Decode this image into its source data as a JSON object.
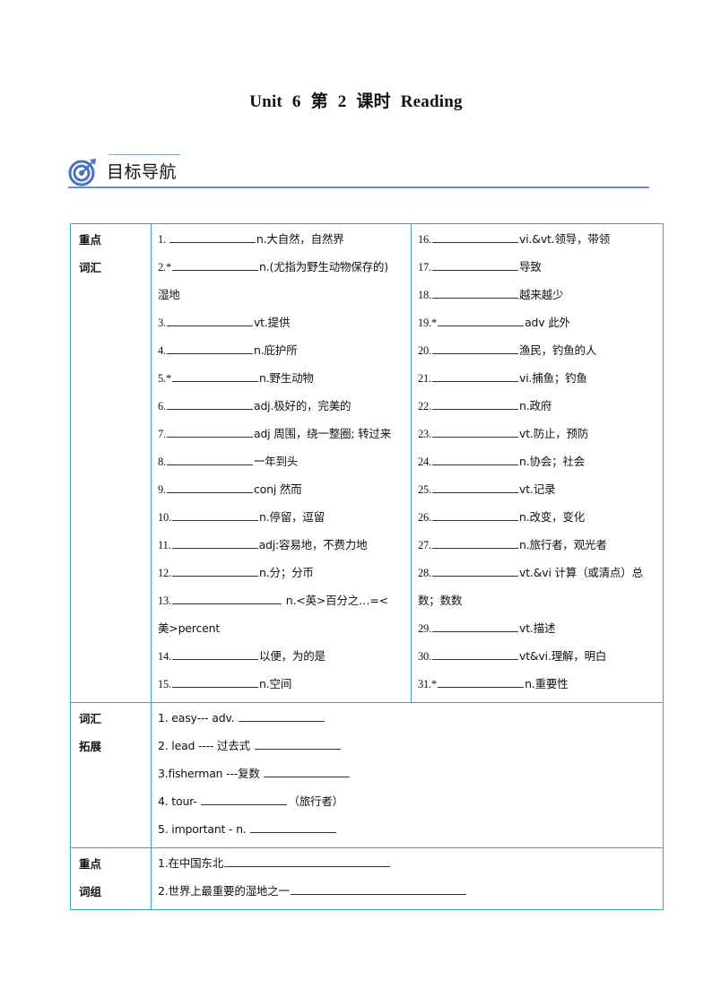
{
  "document": {
    "title_parts": [
      "Unit",
      "6",
      "第",
      "2",
      "课时",
      "Reading"
    ],
    "section_header": {
      "icon": "target-icon",
      "label": "目标导航",
      "accent_color": "#4a72c0"
    }
  },
  "table": {
    "border_color": "#3fa0c0",
    "key_vocab": {
      "category": [
        "重点",
        "词汇"
      ],
      "left": [
        {
          "num": "1. ",
          "tail": "n.大自然，自然界"
        },
        {
          "num": "2.*",
          "tail": "n.(尤指为野生动物保存的)"
        },
        {
          "num": "",
          "tail": "湿地",
          "continuation": true
        },
        {
          "num": "3.",
          "tail": "vt.提供"
        },
        {
          "num": "4.",
          "tail": "n.庇护所"
        },
        {
          "num": "5.*",
          "tail": "n.野生动物"
        },
        {
          "num": "6.",
          "tail": "adj.极好的，完美的"
        },
        {
          "num": "7.",
          "tail": "adj 周围，绕一整圈; 转过来"
        },
        {
          "num": "8.",
          "tail": "一年到头"
        },
        {
          "num": "9.",
          "tail": "conj 然而"
        },
        {
          "num": "10.",
          "tail": "n.停留，逗留"
        },
        {
          "num": "11.",
          "tail": "adj:容易地，不费力地"
        },
        {
          "num": "12.",
          "tail": "n.分；分币"
        },
        {
          "num": "13.",
          "tail": "  n.<英>百分之…=<",
          "long": true
        },
        {
          "num": "",
          "tail": "美>percent",
          "continuation": true
        },
        {
          "num": "14.",
          "tail": "以便，为的是"
        },
        {
          "num": "15.",
          "tail": "n.空间"
        }
      ],
      "right": [
        {
          "num": "16.",
          "tail": "vi.&vt.领导，带领"
        },
        {
          "num": "17.",
          "tail": "导致"
        },
        {
          "num": "18.",
          "tail": "越来越少"
        },
        {
          "num": "19.*",
          "tail": "adv 此外"
        },
        {
          "num": "20.",
          "tail": "渔民，钓鱼的人"
        },
        {
          "num": "21.",
          "tail": "vi.捕鱼；钓鱼"
        },
        {
          "num": "22.",
          "tail": "n.政府"
        },
        {
          "num": "23.",
          "tail": "vt.防止，预防"
        },
        {
          "num": "24.",
          "tail": "n.协会；社会"
        },
        {
          "num": "25.",
          "tail": "vt.记录"
        },
        {
          "num": "26.",
          "tail": "n.改变，变化"
        },
        {
          "num": "27.",
          "tail": "n.旅行者，观光者"
        },
        {
          "num": "28.",
          "tail": "vt.&vi 计算（或清点）总"
        },
        {
          "num": "",
          "tail": "数；数数",
          "continuation": true
        },
        {
          "num": "29.",
          "tail": "vt.描述"
        },
        {
          "num": "30.",
          "tail": "vt&vi.理解，明白"
        },
        {
          "num": "31.*",
          "tail": "n.重要性"
        }
      ]
    },
    "vocab_extension": {
      "category": [
        "词汇",
        "拓展"
      ],
      "items": [
        {
          "prefix": "1. easy--- adv.  ",
          "suffix": ""
        },
        {
          "prefix": "2. lead ---- 过去式  ",
          "suffix": ""
        },
        {
          "prefix": "3.fisherman ---复数  ",
          "suffix": ""
        },
        {
          "prefix": "4. tour-  ",
          "suffix": "（旅行者）"
        },
        {
          "prefix": "5. important - n.  ",
          "suffix": ""
        }
      ]
    },
    "key_phrases": {
      "category": [
        "重点",
        "词组"
      ],
      "items": [
        {
          "prefix": "1.在中国东北"
        },
        {
          "prefix": "2.世界上最重要的湿地之一"
        }
      ]
    }
  }
}
